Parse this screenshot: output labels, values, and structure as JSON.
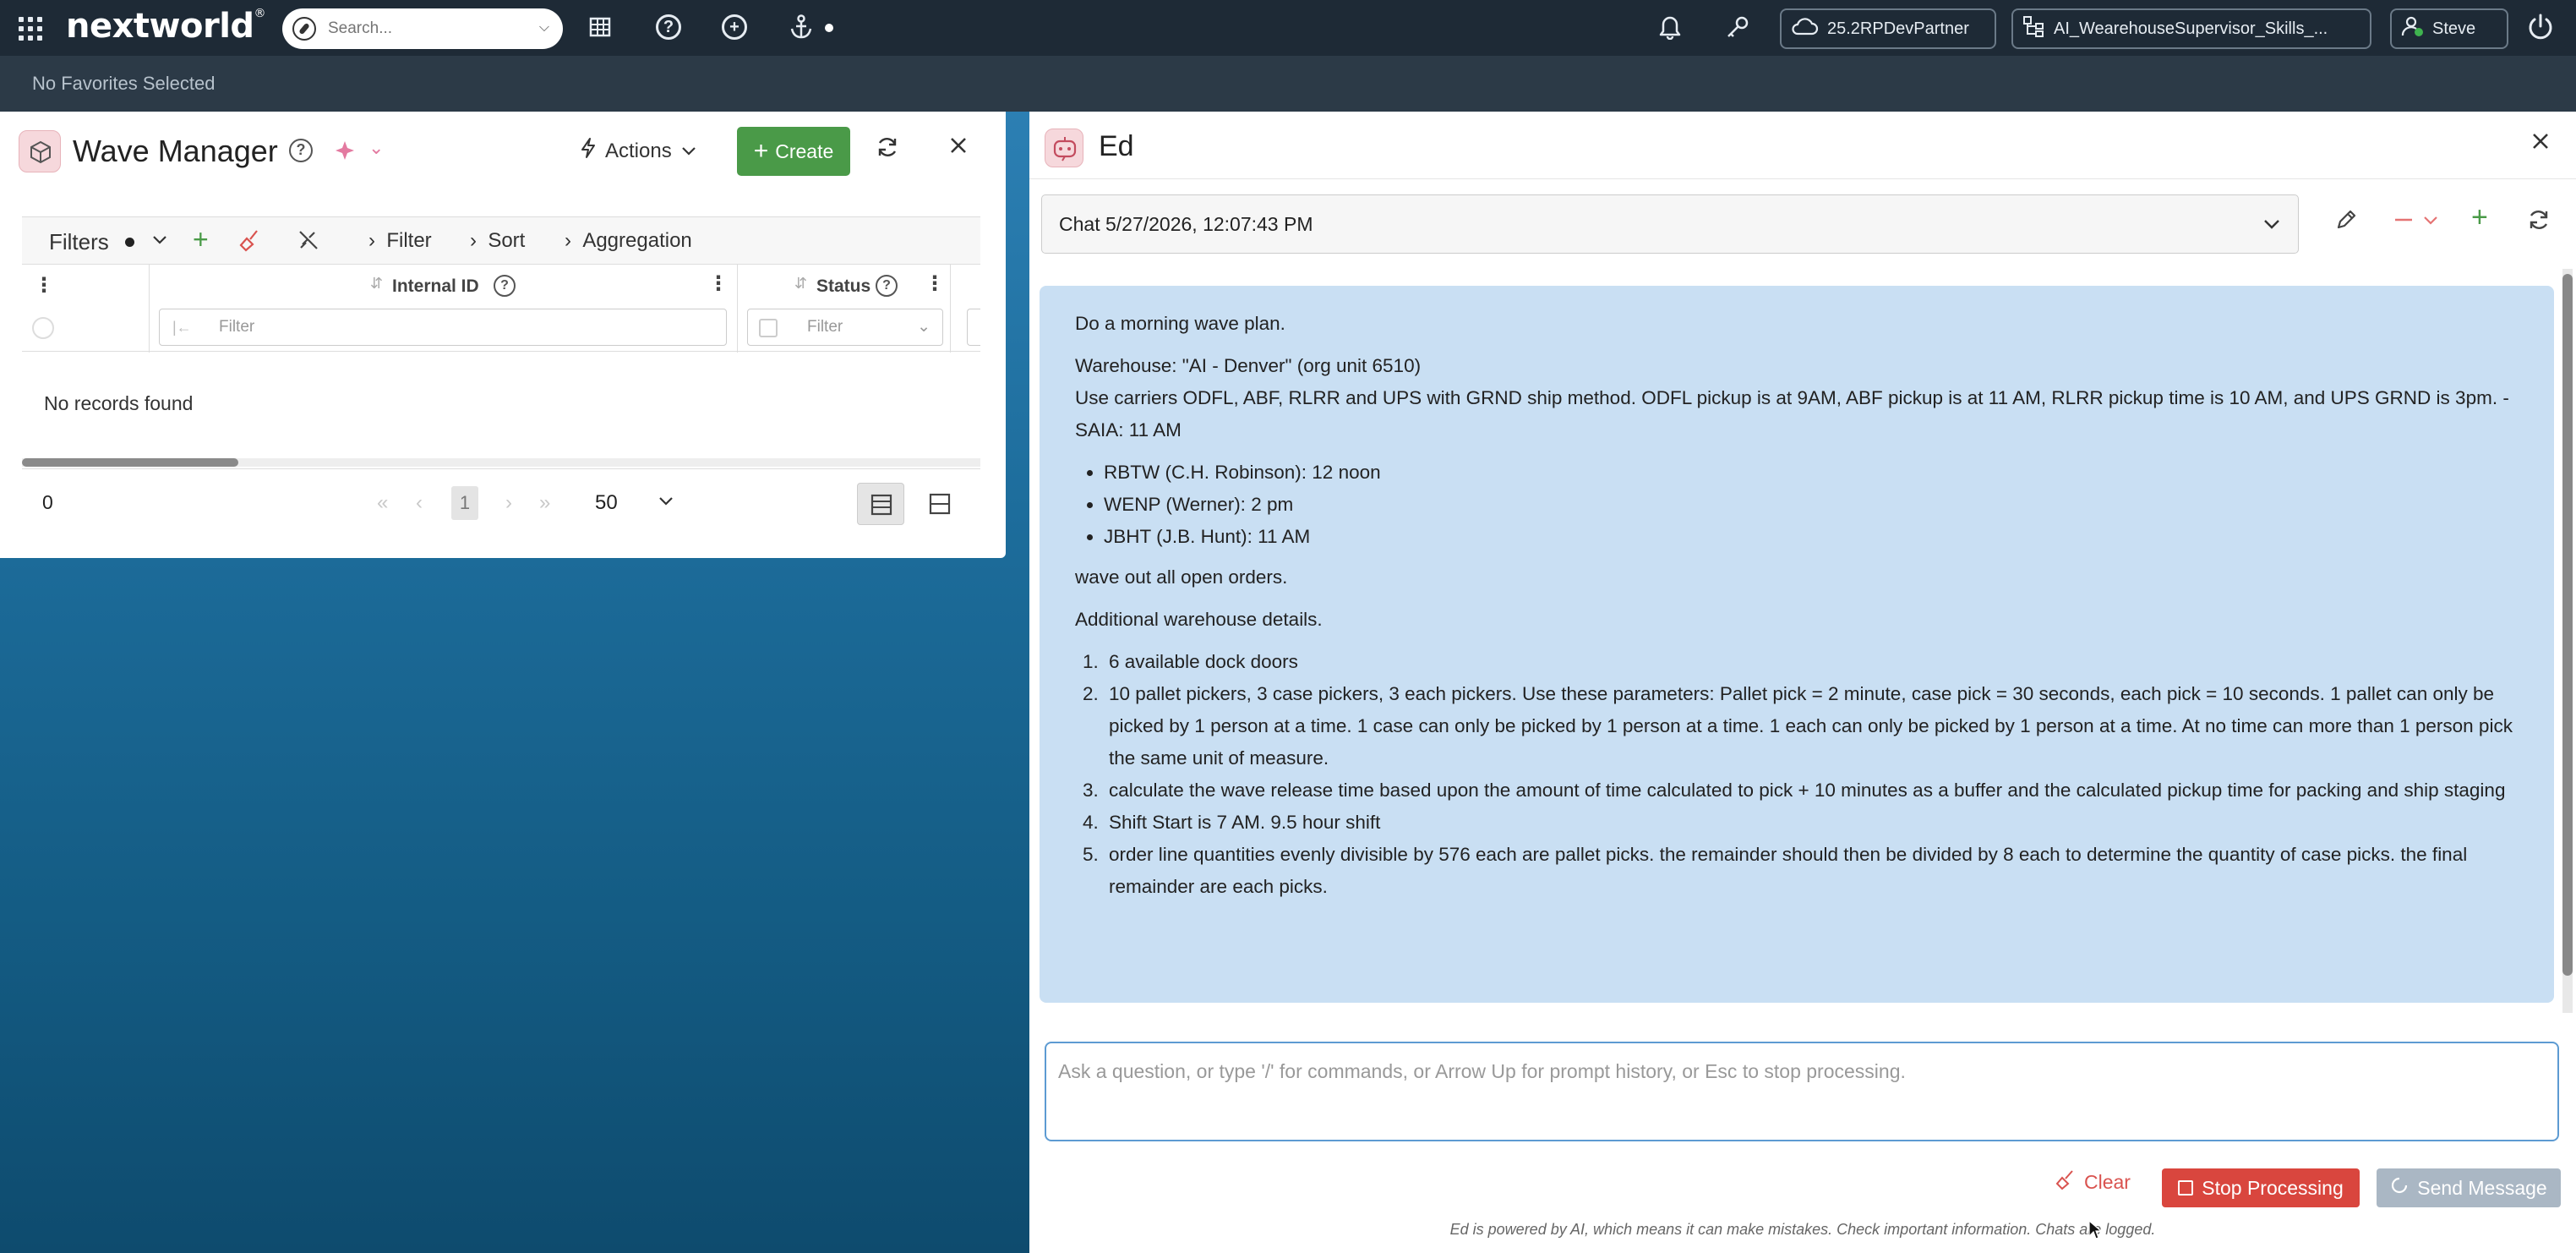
{
  "topbar": {
    "brand": "nextworld",
    "brand_tm": "®",
    "search_placeholder": "Search...",
    "env_label": "25.2RPDevPartner",
    "app_label": "AI_WearehouseSupervisor_Skills_...",
    "user_label": "Steve"
  },
  "favorites": {
    "text": "No Favorites Selected"
  },
  "wave_manager": {
    "title": "Wave Manager",
    "actions_label": "Actions",
    "create_label": "Create",
    "filters_label": "Filters",
    "filter_link": "Filter",
    "sort_link": "Sort",
    "aggregation_link": "Aggregation",
    "columns": [
      {
        "title": "Internal ID",
        "filter_placeholder": "Filter"
      },
      {
        "title": "Status",
        "filter_placeholder": "Filter"
      }
    ],
    "empty_text": "No records found",
    "record_count": "0",
    "current_page": "1",
    "page_size": "50"
  },
  "ed": {
    "title": "Ed",
    "chat_name": "Chat 5/27/2026, 12:07:43 PM",
    "message": {
      "line1": "Do a morning wave plan.",
      "line2": "Warehouse: \"AI - Denver\" (org unit 6510)",
      "line3": "Use carriers ODFL, ABF, RLRR and UPS with GRND ship method. ODFL pickup is at 9AM, ABF pickup is at 11 AM, RLRR pickup time is 10 AM, and UPS GRND is 3pm. - SAIA: 11 AM",
      "bullets": [
        "RBTW (C.H. Robinson): 12 noon",
        "WENP (Werner): 2 pm",
        "JBHT (J.B. Hunt): 11 AM"
      ],
      "line4": "wave out all open orders.",
      "line5": "Additional warehouse details.",
      "numbered": [
        "6 available dock doors",
        "10 pallet pickers, 3 case pickers, 3 each pickers. Use these parameters: Pallet pick = 2 minute, case pick = 30 seconds, each pick = 10 seconds. 1 pallet can only be picked by 1 person at a time. 1 case can only be picked by 1 person at a time. 1 each can only be picked by 1 person at a time. At no time can more than 1 person pick the same unit of measure.",
        "calculate the wave release time based upon the amount of time calculated to pick + 10 minutes as a buffer and the calculated pickup time for packing and ship staging",
        "Shift Start is 7 AM. 9.5 hour shift",
        "order line quantities evenly divisible by 576 each are pallet picks. the remainder should then be divided by 8 each to determine the quantity of case picks. the final remainder are each picks."
      ]
    },
    "prompt_placeholder": "Ask a question, or type '/' for commands, or Arrow Up for prompt history, or Esc to stop processing.",
    "clear_label": "Clear",
    "stop_label": "Stop Processing",
    "send_label": "Send Message",
    "disclaimer": "Ed is powered by AI, which means it can make mistakes. Check important information. Chats are logged."
  }
}
